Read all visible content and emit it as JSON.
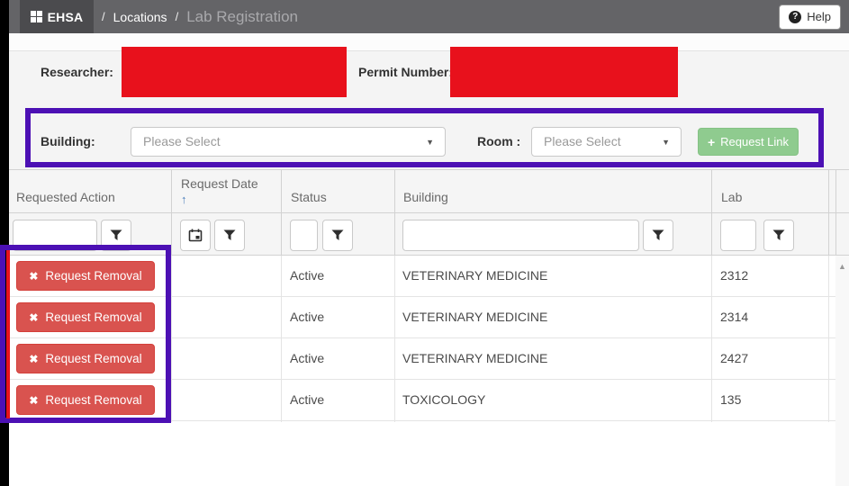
{
  "header": {
    "brand": "EHSA",
    "separator": "/",
    "breadcrumb_section": "Locations",
    "breadcrumb_page": "Lab Registration",
    "help_label": "Help"
  },
  "icons": {
    "question": "?",
    "plus": "+",
    "remove_x": "✖",
    "caret_down": "▼",
    "sort_ascending": "↑",
    "scroll_up": "▲"
  },
  "form": {
    "researcher_label": "Researcher:",
    "permit_number_label": "Permit Number:",
    "building_label": "Building:",
    "room_label": "Room :",
    "building_value": "Please Select",
    "room_value": "Please Select",
    "request_link_label": "Request Link"
  },
  "table": {
    "columns": [
      "Requested Action",
      "Request Date",
      "Status",
      "Building",
      "Lab"
    ],
    "remove_button_label": "Request Removal",
    "rows": [
      {
        "status": "Active",
        "building": "VETERINARY MEDICINE",
        "lab": "2312"
      },
      {
        "status": "Active",
        "building": "VETERINARY MEDICINE",
        "lab": "2314"
      },
      {
        "status": "Active",
        "building": "VETERINARY MEDICINE",
        "lab": "2427"
      },
      {
        "status": "Active",
        "building": "TOXICOLOGY",
        "lab": "135"
      }
    ]
  },
  "colors": {
    "topbar": "#646467",
    "annotation_purple": "#4c10b4",
    "annotation_red": "#e8111c",
    "danger_button": "#d9534f",
    "success_button": "#8fcb8f",
    "sort_arrow": "#4a7ebb"
  }
}
